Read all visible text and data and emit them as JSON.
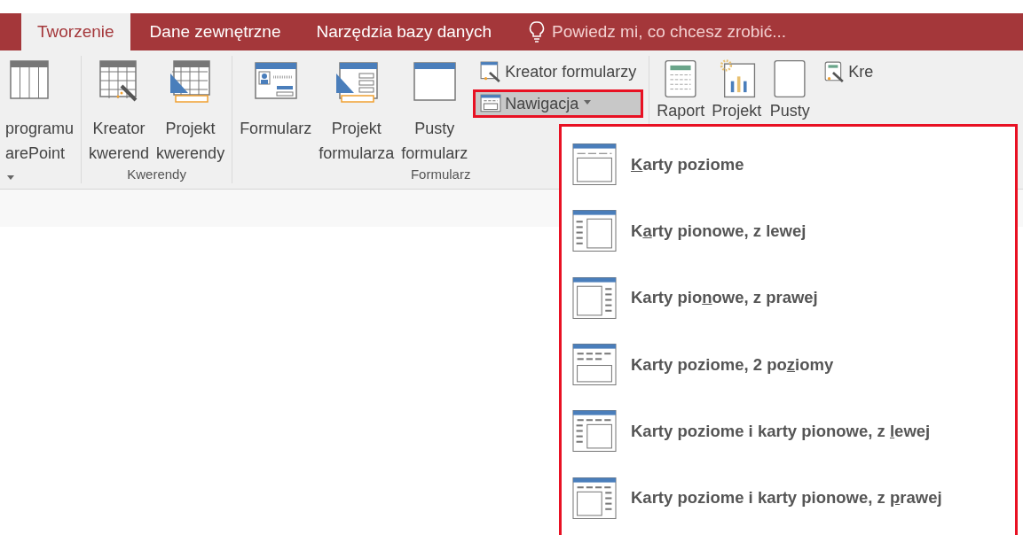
{
  "tabs": [
    {
      "label": "Tworzenie",
      "selected": true
    },
    {
      "label": "Dane zewnętrzne",
      "selected": false
    },
    {
      "label": "Narzędzia bazy danych",
      "selected": false
    }
  ],
  "tell_me": {
    "text": "Powiedz mi, co chcesz zrobić..."
  },
  "ribbon": {
    "groups": [
      {
        "buttons": [
          {
            "kind": "table",
            "label": "programu arePoint",
            "dropdown": true
          }
        ]
      },
      {
        "label": "Kwerendy",
        "buttons": [
          {
            "kind": "query-wizard",
            "label": "Kreator kwerend"
          },
          {
            "kind": "query-design",
            "label": "Projekt kwerendy"
          }
        ]
      },
      {
        "label": "Formularz",
        "buttons": [
          {
            "kind": "form",
            "label": "Formularz"
          },
          {
            "kind": "form-design",
            "label": "Projekt formularza"
          },
          {
            "kind": "blank-form",
            "label": "Pusty formularz"
          }
        ],
        "small_buttons": [
          {
            "kind": "form-wizard",
            "label": "Kreator formularzy"
          },
          {
            "kind": "navigation",
            "label": "Nawigacja",
            "dropdown": true,
            "expanded": true
          }
        ]
      },
      {
        "buttons": [
          {
            "kind": "report",
            "label": "Raport"
          },
          {
            "kind": "report-design",
            "label": "Projekt"
          },
          {
            "kind": "blank-report",
            "label": "Pusty"
          }
        ],
        "small_buttons": [
          {
            "kind": "report-wizard",
            "label": "Kre"
          }
        ]
      }
    ]
  },
  "navigation_menu": [
    {
      "kind": "horizontal",
      "key": "K",
      "after": "arty poziome"
    },
    {
      "kind": "vertical-left",
      "before": "K",
      "key": "a",
      "after": "rty pionowe, z lewej"
    },
    {
      "kind": "vertical-right",
      "before": "Karty pio",
      "key": "n",
      "after": "owe, z prawej"
    },
    {
      "kind": "horizontal-2",
      "before": "Karty poziome, 2 po",
      "key": "z",
      "after": "iomy"
    },
    {
      "kind": "horizontal-vertical-left",
      "before": "Karty poziome i karty pionowe, z ",
      "key": "l",
      "after": "ewej"
    },
    {
      "kind": "horizontal-vertical-right",
      "before": "Karty poziome i karty pionowe, z ",
      "key": "p",
      "after": "rawej"
    }
  ]
}
